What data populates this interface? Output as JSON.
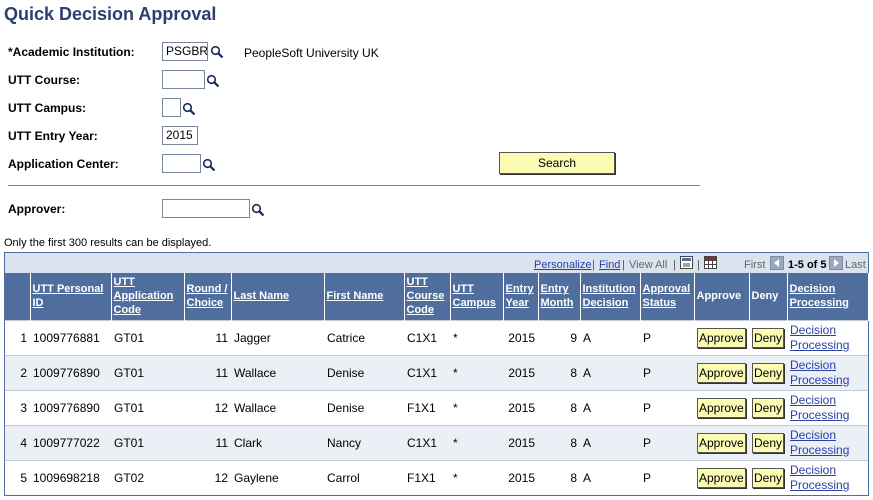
{
  "page": {
    "title": "Quick Decision Approval"
  },
  "form": {
    "institution": {
      "label": "*Academic Institution:",
      "value": "PSGBR",
      "description": "PeopleSoft University UK"
    },
    "course": {
      "label": "UTT Course:",
      "value": ""
    },
    "campus": {
      "label": "UTT Campus:",
      "value": ""
    },
    "entry_year": {
      "label": "UTT Entry Year:",
      "value": "2015"
    },
    "app_center": {
      "label": "Application Center:",
      "value": ""
    },
    "search_label": "Search",
    "approver": {
      "label": "Approver:",
      "value": ""
    }
  },
  "note": "Only the first 300 results can be displayed.",
  "grid": {
    "nav": {
      "personalize": "Personalize",
      "find": "Find",
      "view_all": "View All",
      "first": "First",
      "range": "1-5 of 5",
      "last": "Last",
      "sep": "|"
    },
    "headers": {
      "personal_id": "UTT Personal ID",
      "app_code": "UTT Application Code",
      "round": "Round / Choice",
      "last_name": "Last Name",
      "first_name": "First Name",
      "course_code": "UTT Course Code",
      "campus": "UTT Campus",
      "entry_year": "Entry Year",
      "entry_month": "Entry Month",
      "inst_decision": "Institution Decision",
      "approval_status": "Approval Status",
      "approve": "Approve",
      "deny": "Deny",
      "decision_processing": "Decision Processing"
    },
    "rows": [
      {
        "n": "1",
        "id": "1009776881",
        "app": "GT01",
        "round": "11",
        "last": "Jagger",
        "first": "Catrice",
        "course": "C1X1",
        "campus": "*",
        "year": "2015",
        "month": "9",
        "decision": "A",
        "status": "P",
        "approve": "Approve",
        "deny": "Deny",
        "proc1": "Decision",
        "proc2": "Processing"
      },
      {
        "n": "2",
        "id": "1009776890",
        "app": "GT01",
        "round": "11",
        "last": "Wallace",
        "first": "Denise",
        "course": "C1X1",
        "campus": "*",
        "year": "2015",
        "month": "8",
        "decision": "A",
        "status": "P",
        "approve": "Approve",
        "deny": "Deny",
        "proc1": "Decision",
        "proc2": "Processing"
      },
      {
        "n": "3",
        "id": "1009776890",
        "app": "GT01",
        "round": "12",
        "last": "Wallace",
        "first": "Denise",
        "course": "F1X1",
        "campus": "*",
        "year": "2015",
        "month": "8",
        "decision": "A",
        "status": "P",
        "approve": "Approve",
        "deny": "Deny",
        "proc1": "Decision",
        "proc2": "Processing"
      },
      {
        "n": "4",
        "id": "1009777022",
        "app": "GT01",
        "round": "11",
        "last": "Clark",
        "first": "Nancy",
        "course": "C1X1",
        "campus": "*",
        "year": "2015",
        "month": "8",
        "decision": "A",
        "status": "P",
        "approve": "Approve",
        "deny": "Deny",
        "proc1": "Decision",
        "proc2": "Processing"
      },
      {
        "n": "5",
        "id": "1009698218",
        "app": "GT02",
        "round": "12",
        "last": "Gaylene",
        "first": "Carrol",
        "course": "F1X1",
        "campus": "*",
        "year": "2015",
        "month": "8",
        "decision": "A",
        "status": "P",
        "approve": "Approve",
        "deny": "Deny",
        "proc1": "Decision",
        "proc2": "Processing"
      }
    ]
  }
}
